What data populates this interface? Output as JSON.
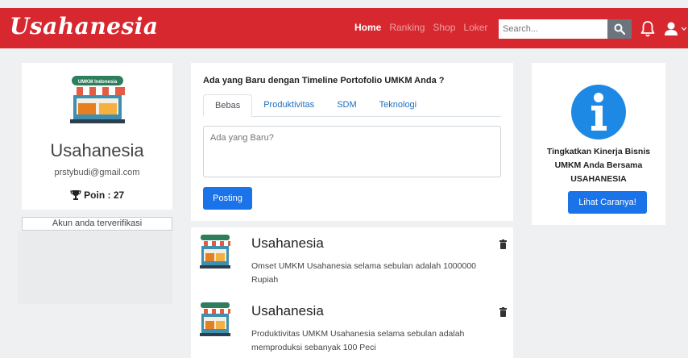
{
  "navbar": {
    "brand": "Usahanesia",
    "links": [
      "Home",
      "Ranking",
      "Shop",
      "Loker"
    ],
    "search_placeholder": "Search..."
  },
  "profile": {
    "name": "Usahanesia",
    "email": "prstybudi@gmail.com",
    "points": "Poin : 27",
    "verified": "Akun anda terverifikasi",
    "logo_text": "UMKM Indonesia"
  },
  "post": {
    "heading": "Ada yang Baru dengan Timeline Portofolio UMKM Anda ?",
    "tabs": [
      "Bebas",
      "Produktivitas",
      "SDM",
      "Teknologi"
    ],
    "textarea_placeholder": "Ada yang Baru?",
    "button": "Posting"
  },
  "feed": [
    {
      "title": "Usahanesia",
      "text": "Omset UMKM Usahanesia selama sebulan adalah 1000000 Rupiah"
    },
    {
      "title": "Usahanesia",
      "text": "Produktivitas UMKM Usahanesia selama sebulan adalah memproduksi sebanyak 100 Peci"
    }
  ],
  "info": {
    "text": "Tingkatkan Kinerja Bisnis UMKM Anda Bersama USAHANESIA",
    "button": "Lihat Caranya!"
  },
  "colors": {
    "navbar": "#d8282f",
    "primary": "#1a73e8"
  }
}
